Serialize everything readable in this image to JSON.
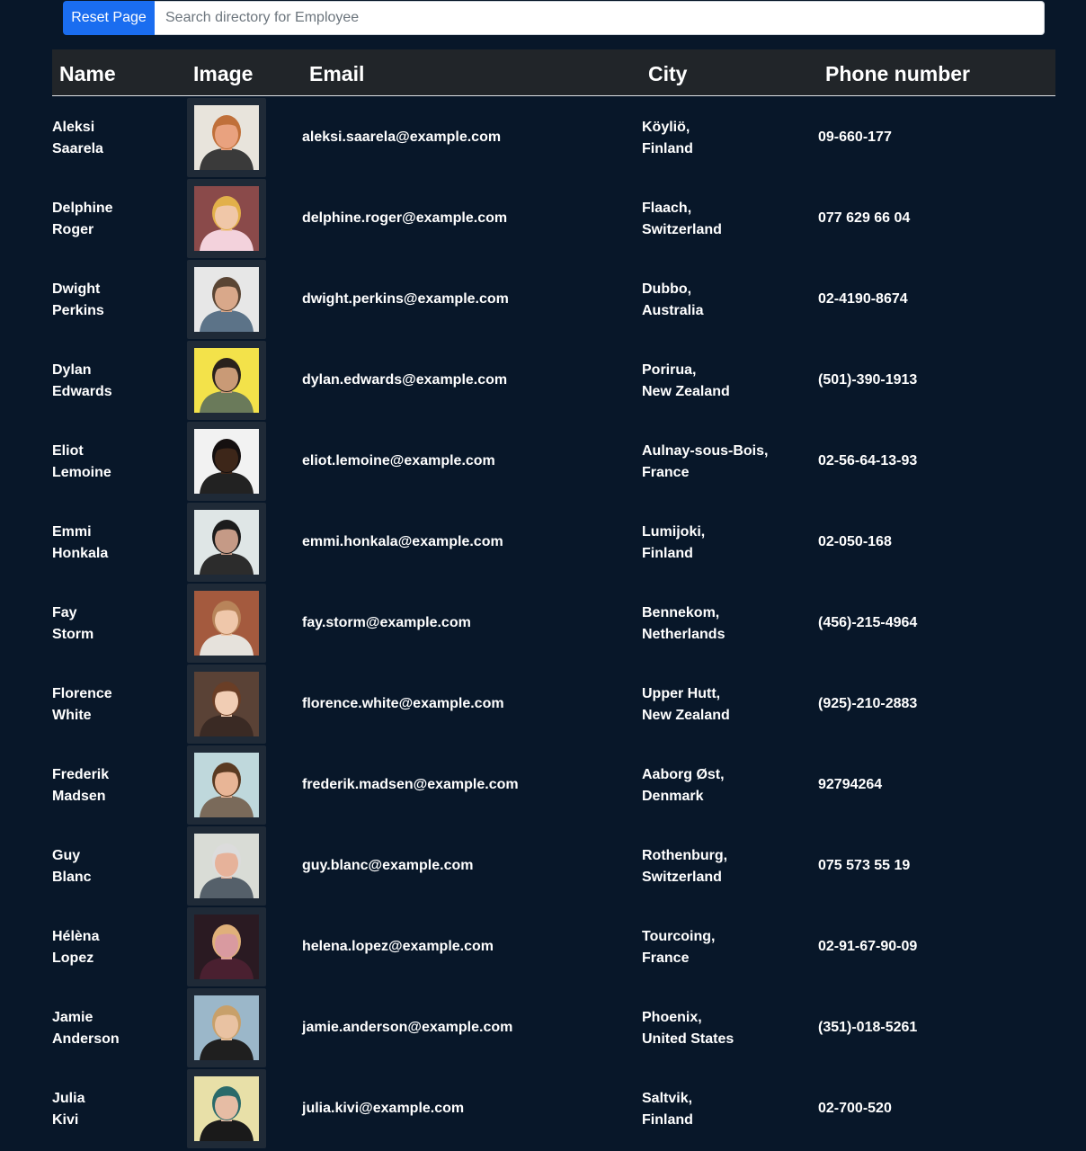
{
  "toolbar": {
    "reset_label": "Reset Page",
    "search_placeholder": "Search directory for Employee",
    "search_value": ""
  },
  "table": {
    "headers": [
      "Name",
      "Image",
      "Email",
      "City",
      "Phone number"
    ],
    "rows": [
      {
        "first": "Aleksi",
        "last": "Saarela",
        "email": "aleksi.saarela@example.com",
        "city": "Köyliö,",
        "country": "Finland",
        "phone": "09-660-177",
        "photo": {
          "bg": "#e8e4dc",
          "skin": "#e9a27f",
          "hair": "#c0703a",
          "shirt": "#3a3a3a"
        }
      },
      {
        "first": "Delphine",
        "last": "Roger",
        "email": "delphine.roger@example.com",
        "city": "Flaach,",
        "country": "Switzerland",
        "phone": "077 629 66 04",
        "photo": {
          "bg": "#8a4a4a",
          "skin": "#f0c7a8",
          "hair": "#e2b04a",
          "shirt": "#f3d2dc"
        }
      },
      {
        "first": "Dwight",
        "last": "Perkins",
        "email": "dwight.perkins@example.com",
        "city": "Dubbo,",
        "country": "Australia",
        "phone": "02-4190-8674",
        "photo": {
          "bg": "#e7e7e7",
          "skin": "#d9a88a",
          "hair": "#5a4534",
          "shirt": "#5c7388"
        }
      },
      {
        "first": "Dylan",
        "last": "Edwards",
        "email": "dylan.edwards@example.com",
        "city": "Porirua,",
        "country": "New Zealand",
        "phone": "(501)-390-1913",
        "photo": {
          "bg": "#f3e24a",
          "skin": "#c99a76",
          "hair": "#2a221c",
          "shirt": "#6a7a5a"
        }
      },
      {
        "first": "Eliot",
        "last": "Lemoine",
        "email": "eliot.lemoine@example.com",
        "city": "Aulnay-sous-Bois,",
        "country": "France",
        "phone": "02-56-64-13-93",
        "photo": {
          "bg": "#f2f2f2",
          "skin": "#3d2619",
          "hair": "#151010",
          "shirt": "#222222"
        }
      },
      {
        "first": "Emmi",
        "last": "Honkala",
        "email": "emmi.honkala@example.com",
        "city": "Lumijoki,",
        "country": "Finland",
        "phone": "02-050-168",
        "photo": {
          "bg": "#dfe6e6",
          "skin": "#c59a86",
          "hair": "#1c1c1c",
          "shirt": "#2c2c2c"
        }
      },
      {
        "first": "Fay",
        "last": "Storm",
        "email": "fay.storm@example.com",
        "city": "Bennekom,",
        "country": "Netherlands",
        "phone": "(456)-215-4964",
        "photo": {
          "bg": "#a45a3e",
          "skin": "#efc7aa",
          "hair": "#b8845a",
          "shirt": "#e6e2dc"
        }
      },
      {
        "first": "Florence",
        "last": "White",
        "email": "florence.white@example.com",
        "city": "Upper Hutt,",
        "country": "New Zealand",
        "phone": "(925)-210-2883",
        "photo": {
          "bg": "#5a4236",
          "skin": "#f1cdb4",
          "hair": "#6a3e26",
          "shirt": "#3a2a24"
        }
      },
      {
        "first": "Frederik",
        "last": "Madsen",
        "email": "frederik.madsen@example.com",
        "city": "Aaborg Øst,",
        "country": "Denmark",
        "phone": "92794264",
        "photo": {
          "bg": "#bfd8dc",
          "skin": "#e8b596",
          "hair": "#5a3a22",
          "shirt": "#7a6a5a"
        }
      },
      {
        "first": "Guy",
        "last": "Blanc",
        "email": "guy.blanc@example.com",
        "city": "Rothenburg,",
        "country": "Switzerland",
        "phone": "075 573 55 19",
        "photo": {
          "bg": "#d9dcd6",
          "skin": "#e6b29a",
          "hair": "#dcdcdc",
          "shirt": "#55606a"
        }
      },
      {
        "first": "Hélèna",
        "last": "Lopez",
        "email": "helena.lopez@example.com",
        "city": "Tourcoing,",
        "country": "France",
        "phone": "02-91-67-90-09",
        "photo": {
          "bg": "#2a1a22",
          "skin": "#d99aa0",
          "hair": "#e0b07a",
          "shirt": "#4a2030"
        }
      },
      {
        "first": "Jamie",
        "last": "Anderson",
        "email": "jamie.anderson@example.com",
        "city": "Phoenix,",
        "country": "United States",
        "phone": "(351)-018-5261",
        "photo": {
          "bg": "#9bb7c9",
          "skin": "#e9c2a2",
          "hair": "#c8a06a",
          "shirt": "#1f1f1f"
        }
      },
      {
        "first": "Julia",
        "last": "Kivi",
        "email": "julia.kivi@example.com",
        "city": "Saltvik,",
        "country": "Finland",
        "phone": "02-700-520",
        "photo": {
          "bg": "#e8e0a8",
          "skin": "#e6bca4",
          "hair": "#2a6a6a",
          "shirt": "#1a1a1a"
        }
      }
    ]
  }
}
